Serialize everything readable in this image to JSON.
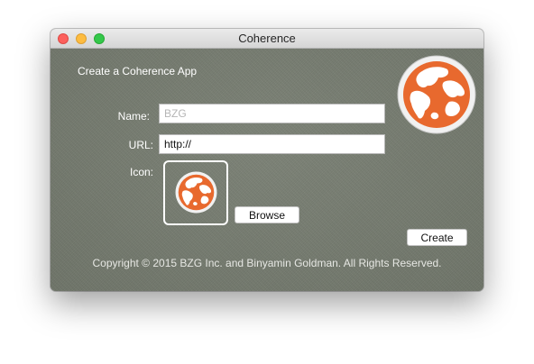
{
  "window": {
    "title": "Coherence"
  },
  "form": {
    "heading": "Create a Coherence App",
    "name_label": "Name:",
    "name_value": "",
    "name_placeholder": "BZG",
    "url_label": "URL:",
    "url_value": "http://",
    "icon_label": "Icon:",
    "browse_label": "Browse",
    "create_label": "Create"
  },
  "footer": {
    "copyright": "Copyright © 2015 BZG Inc. and Binyamin Goldman. All Rights Reserved."
  },
  "icons": {
    "app_logo": "globe-icon",
    "icon_preview": "globe-icon"
  },
  "colors": {
    "background": "#767c70",
    "globe_orange": "#e8692e",
    "globe_land": "#ffffff"
  }
}
